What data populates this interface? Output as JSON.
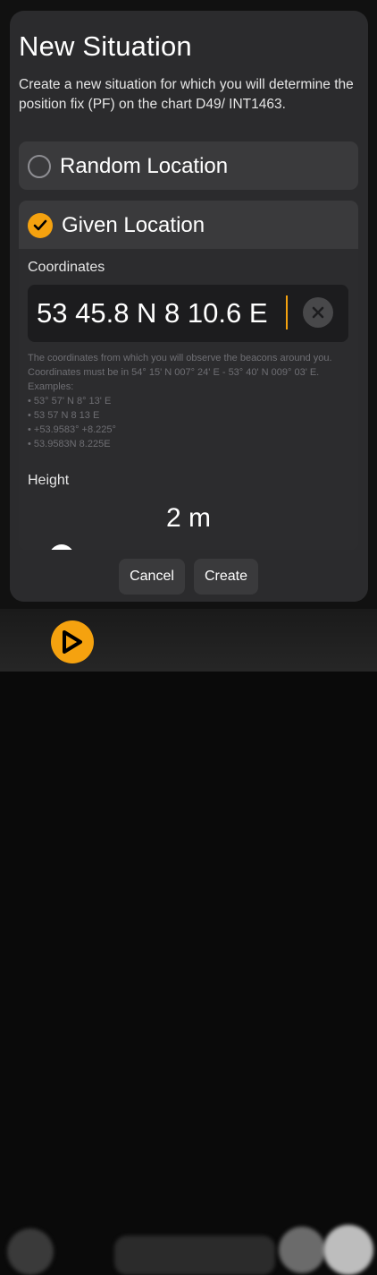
{
  "dialog": {
    "title": "New Situation",
    "description": "Create a new situation for which you will determine the position fix (PF) on the chart D49/ INT1463."
  },
  "options": {
    "random_label": "Random Location",
    "given_label": "Given Location",
    "selected": "given"
  },
  "coordinates": {
    "label": "Coordinates",
    "value": "53 45.8 N 8 10.6 E",
    "help_lines": [
      "The coordinates from which you will observe the beacons around you. Coordinates must be in 54° 15' N 007° 24' E - 53° 40' N 009° 03' E. Examples:",
      "• 53° 57' N 8° 13' E",
      "• 53 57 N 8 13 E",
      "• +53.9583° +8.225°",
      "• 53.9583N 8.225E"
    ]
  },
  "height": {
    "label": "Height",
    "value": "2 m",
    "slider_fraction": 0.02
  },
  "buttons": {
    "cancel": "Cancel",
    "create": "Create"
  },
  "colors": {
    "accent": "#f5a20f",
    "card": "#3a3a3c",
    "modal": "#2b2b2d"
  }
}
